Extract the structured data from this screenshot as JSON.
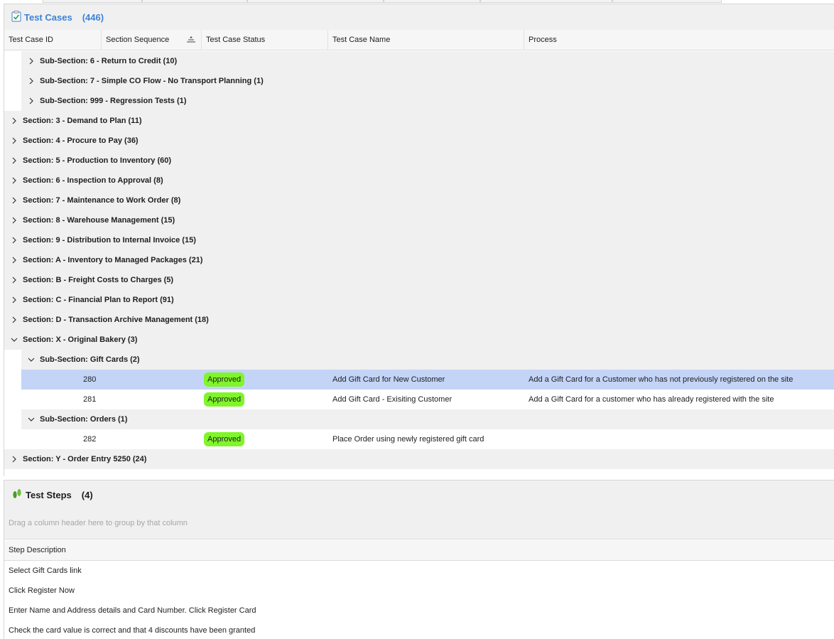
{
  "test_cases": {
    "title": "Test Cases",
    "count": "(446)",
    "columns": [
      "Test Case ID",
      "Section Sequence",
      "Test Case Status",
      "Test Case Name",
      "Process"
    ],
    "groups_top": [
      {
        "level": "sub",
        "label": "Sub-Section: 6 - Return to Credit (10)",
        "expanded": false
      },
      {
        "level": "sub",
        "label": "Sub-Section: 7 - Simple CO Flow - No Transport Planning (1)",
        "expanded": false
      },
      {
        "level": "sub",
        "label": "Sub-Section: 999 - Regression Tests (1)",
        "expanded": false
      },
      {
        "level": "section",
        "label": "Section: 3 - Demand to Plan (11)",
        "expanded": false
      },
      {
        "level": "section",
        "label": "Section: 4 - Procure to Pay (36)",
        "expanded": false
      },
      {
        "level": "section",
        "label": "Section: 5 - Production to Inventory (60)",
        "expanded": false
      },
      {
        "level": "section",
        "label": "Section: 6 - Inspection to Approval (8)",
        "expanded": false
      },
      {
        "level": "section",
        "label": "Section: 7 - Maintenance to Work Order (8)",
        "expanded": false
      },
      {
        "level": "section",
        "label": "Section: 8 - Warehouse Management (15)",
        "expanded": false
      },
      {
        "level": "section",
        "label": "Section: 9 - Distribution to Internal Invoice (15)",
        "expanded": false
      },
      {
        "level": "section",
        "label": "Section: A - Inventory to Managed Packages (21)",
        "expanded": false
      },
      {
        "level": "section",
        "label": "Section: B - Freight Costs to Charges (5)",
        "expanded": false
      },
      {
        "level": "section",
        "label": "Section: C - Financial Plan to Report (91)",
        "expanded": false
      },
      {
        "level": "section",
        "label": "Section: D - Transaction Archive Management (18)",
        "expanded": false
      },
      {
        "level": "section",
        "label": "Section: X - Original Bakery (3)",
        "expanded": true
      }
    ],
    "subsection_gift": "Sub-Section: Gift Cards (2)",
    "rows_gift": [
      {
        "id": "280",
        "status": "Approved",
        "name": "Add Gift Card for New Customer",
        "process": "Add a Gift Card for a Customer who has not previously registered on the site",
        "selected": true
      },
      {
        "id": "281",
        "status": "Approved",
        "name": "Add Gift Card - Exisiting Customer",
        "process": "Add a Gift Card for a customer who has already registered with the site",
        "selected": false
      }
    ],
    "subsection_orders": "Sub-Section: Orders (1)",
    "rows_orders": [
      {
        "id": "282",
        "status": "Approved",
        "name": "Place Order using newly registered gift card",
        "process": ""
      }
    ],
    "last_section": "Section: Y - Order Entry 5250 (24)",
    "colors": {
      "title": "#3c82d8",
      "approved": "#7ff52a",
      "selected_row": "#c3d4f7",
      "group_bg": "#f0f0f0"
    }
  },
  "test_steps": {
    "title": "Test Steps",
    "count": "(4)",
    "group_hint": "Drag a column header here to group by that column",
    "column": "Step Description",
    "steps": [
      "Select Gift Cards link",
      "Click Register Now",
      "Enter Name and Address details and Card Number. Click Register Card",
      "Check the card value is correct and that 4 discounts have been granted"
    ]
  }
}
